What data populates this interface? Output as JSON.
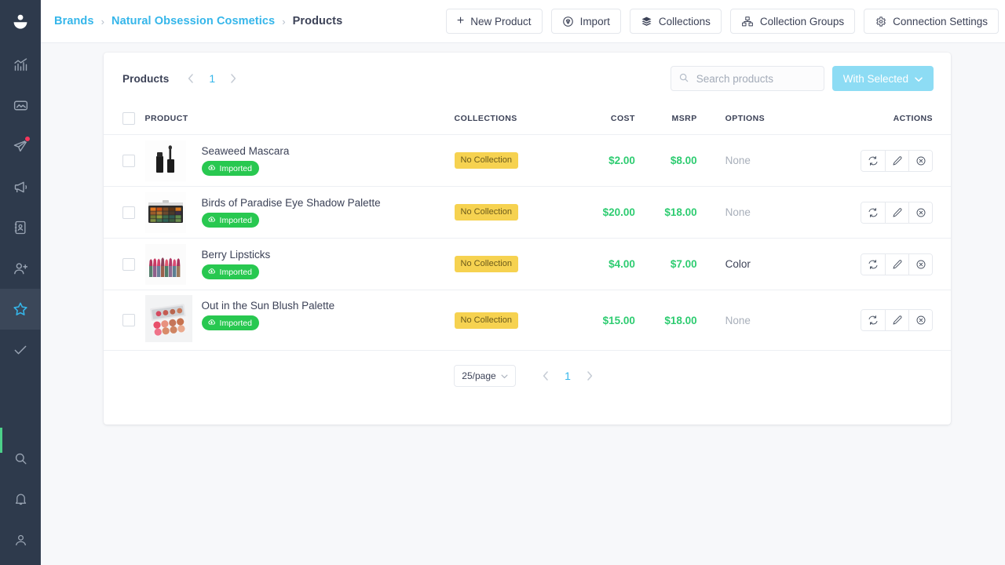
{
  "colors": {
    "sidebar_bg": "#2e3a4c",
    "accent_blue": "#35b6ea",
    "btn_light_blue": "#8ddcf4",
    "badge_green": "#28c850",
    "badge_yellow": "#f6d250",
    "money_green": "#2ecc71",
    "notify_red": "#f5365c",
    "sidebar_accent_green": "#4cd08a"
  },
  "sidebar": {
    "logo_icon": "user-smile-logo-icon",
    "items": [
      {
        "icon": "analytics-chart-icon",
        "name": "sidebar-item-analytics",
        "active": false,
        "badge": false
      },
      {
        "icon": "media-image-icon",
        "name": "sidebar-item-media",
        "active": false,
        "badge": false
      },
      {
        "icon": "paper-plane-icon",
        "name": "sidebar-item-messages",
        "active": false,
        "badge": true
      },
      {
        "icon": "megaphone-icon",
        "name": "sidebar-item-campaigns",
        "active": false,
        "badge": false
      },
      {
        "icon": "address-book-icon",
        "name": "sidebar-item-contacts",
        "active": false,
        "badge": false
      },
      {
        "icon": "add-user-icon",
        "name": "sidebar-item-add-user",
        "active": false,
        "badge": false
      },
      {
        "icon": "star-icon",
        "name": "sidebar-item-brands",
        "active": true,
        "badge": false
      },
      {
        "icon": "check-icon",
        "name": "sidebar-item-tasks",
        "active": false,
        "badge": false
      }
    ],
    "bottom_items": [
      {
        "icon": "search-icon",
        "name": "sidebar-item-search"
      },
      {
        "icon": "bell-icon",
        "name": "sidebar-item-notifications"
      },
      {
        "icon": "account-person-icon",
        "name": "sidebar-item-account"
      }
    ]
  },
  "topbar": {
    "breadcrumb": [
      {
        "label": "Brands",
        "current": false
      },
      {
        "label": "Natural Obsession Cosmetics",
        "current": false
      },
      {
        "label": "Products",
        "current": true
      }
    ],
    "separator": "›",
    "buttons": [
      {
        "label": "New Product",
        "icon": "plus-icon"
      },
      {
        "label": "Import",
        "icon": "cloud-download-icon"
      },
      {
        "label": "Collections",
        "icon": "layers-icon"
      },
      {
        "label": "Collection Groups",
        "icon": "group-boxes-icon"
      },
      {
        "label": "Connection Settings",
        "icon": "gear-icon"
      }
    ]
  },
  "card": {
    "title": "Products",
    "header_pager": {
      "prev_icon": "chevron-left-icon",
      "page": "1",
      "next_icon": "chevron-right-icon"
    },
    "search": {
      "placeholder": "Search products",
      "value": "",
      "icon": "search-icon"
    },
    "with_selected": {
      "label": "With Selected",
      "caret_icon": "chevron-down-icon"
    },
    "table": {
      "columns": [
        "PRODUCT",
        "COLLECTIONS",
        "COST",
        "MSRP",
        "OPTIONS",
        "ACTIONS"
      ],
      "select_all_checked": false,
      "rows": [
        {
          "name": "Seaweed Mascara",
          "thumb": "mascara-thumbnail",
          "status_badge": "Imported",
          "status_icon": "cloud-download-icon",
          "collection": "No Collection",
          "cost": "$2.00",
          "msrp": "$8.00",
          "options": "None",
          "options_empty": true,
          "checked": false,
          "actions": [
            "sync-icon",
            "edit-pencil-icon",
            "remove-circle-icon"
          ]
        },
        {
          "name": "Birds of Paradise Eye Shadow Palette",
          "thumb": "eyeshadow-palette-thumbnail",
          "status_badge": "Imported",
          "status_icon": "cloud-download-icon",
          "collection": "No Collection",
          "cost": "$20.00",
          "msrp": "$18.00",
          "options": "None",
          "options_empty": true,
          "checked": false,
          "actions": [
            "sync-icon",
            "edit-pencil-icon",
            "remove-circle-icon"
          ]
        },
        {
          "name": "Berry Lipsticks",
          "thumb": "lipsticks-thumbnail",
          "status_badge": "Imported",
          "status_icon": "cloud-download-icon",
          "collection": "No Collection",
          "cost": "$4.00",
          "msrp": "$7.00",
          "options": "Color",
          "options_empty": false,
          "checked": false,
          "actions": [
            "sync-icon",
            "edit-pencil-icon",
            "remove-circle-icon"
          ]
        },
        {
          "name": "Out in the Sun Blush Palette",
          "thumb": "blush-palette-thumbnail",
          "status_badge": "Imported",
          "status_icon": "cloud-download-icon",
          "collection": "No Collection",
          "cost": "$15.00",
          "msrp": "$18.00",
          "options": "None",
          "options_empty": true,
          "checked": false,
          "actions": [
            "sync-icon",
            "edit-pencil-icon",
            "remove-circle-icon"
          ]
        }
      ]
    },
    "footer": {
      "per_page": "25/page",
      "per_page_caret": "chevron-down-icon",
      "prev_icon": "chevron-left-icon",
      "page": "1",
      "next_icon": "chevron-right-icon"
    }
  }
}
